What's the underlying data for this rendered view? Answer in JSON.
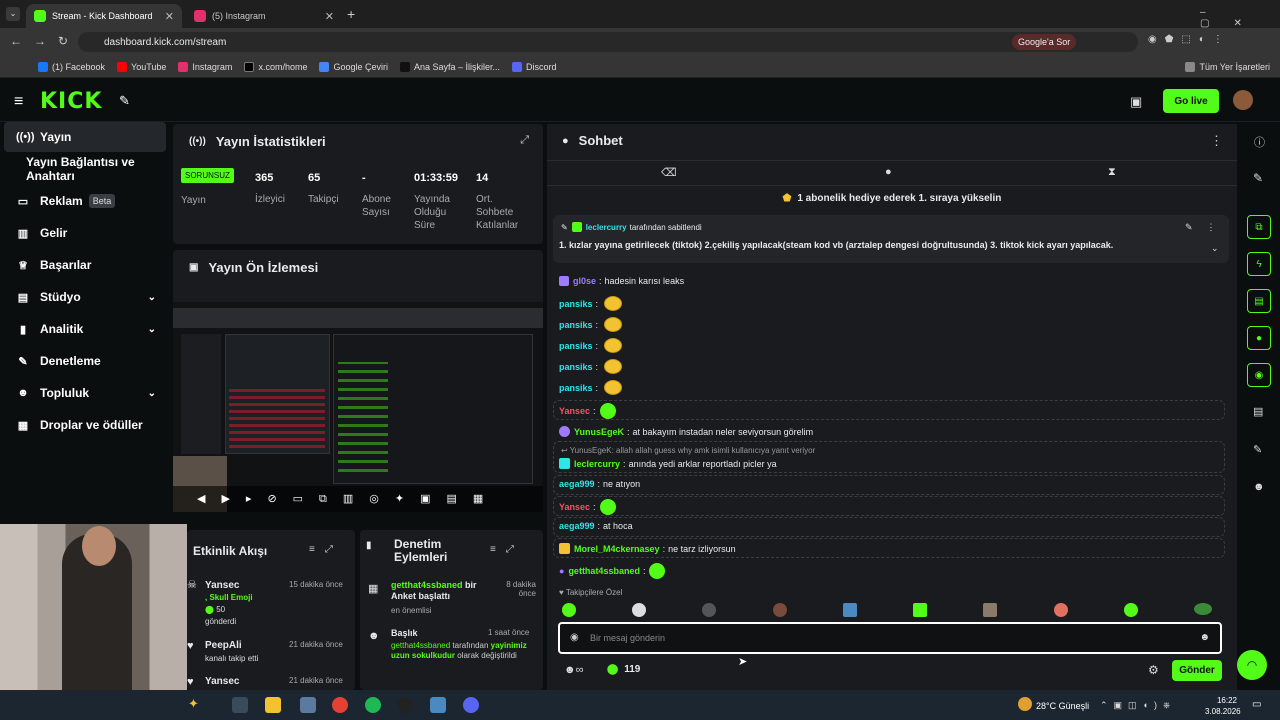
{
  "browser": {
    "tabs": [
      {
        "label": "Stream - Kick Dashboard"
      },
      {
        "label": "(5) Instagram"
      }
    ],
    "url": "dashboard.kick.com/stream",
    "google_btn": "Google'a Sor",
    "bookmarks": [
      "(1) Facebook",
      "YouTube",
      "Instagram",
      "x.com/home",
      "Google Çeviri",
      "Ana Sayfa – İlişkiler...",
      "Discord"
    ],
    "all_bookmarks": "Tüm Yer İşaretleri"
  },
  "header": {
    "logo": "KICK",
    "go_live": "Go live"
  },
  "sidebar": {
    "items": [
      {
        "label": "Yayın"
      },
      {
        "label": "Yayın Bağlantısı ve Anahtarı"
      },
      {
        "label": "Reklam",
        "badge": "Beta"
      },
      {
        "label": "Gelir"
      },
      {
        "label": "Başarılar"
      },
      {
        "label": "Stüdyo"
      },
      {
        "label": "Analitik"
      },
      {
        "label": "Denetleme"
      },
      {
        "label": "Topluluk"
      },
      {
        "label": "Droplar ve ödüller"
      }
    ]
  },
  "stats": {
    "title": "Yayın İstatistikleri",
    "badge": "SORUNSUZ",
    "items": [
      {
        "value": "",
        "label": "Yayın"
      },
      {
        "value": "365",
        "label": "İzleyici"
      },
      {
        "value": "65",
        "label": "Takipçi"
      },
      {
        "value": "-",
        "label": "Abone Sayısı"
      },
      {
        "value": "01:33:59",
        "label": "Yayında Olduğu Süre"
      },
      {
        "value": "14",
        "label": "Ort. Sohbete Katılanlar"
      }
    ]
  },
  "preview": {
    "title": "Yayın Ön İzlemesi"
  },
  "activity": {
    "title": "Etkinlik Akışı",
    "items": [
      {
        "user": "Yansec",
        "time": "15 dakika önce",
        "line1": ", Skull Emoji",
        "line2": "50",
        "line3": "gönderdi"
      },
      {
        "user": "PeepAli",
        "time": "21 dakika önce",
        "line1": "kanalı takip etti"
      },
      {
        "user": "Yansec",
        "time": "21 dakika önce"
      }
    ]
  },
  "moderation": {
    "title": "Denetim Eylemleri",
    "items": [
      {
        "user": "getthat4ssbaned",
        "text": "bir Anket başlattı",
        "sub": "en önemlisi",
        "time": "8 dakika önce"
      },
      {
        "user": "Başlık",
        "time": "1 saat önce",
        "line1": "getthat4ssbaned",
        "line1b": "tarafından",
        "line2": "yayinimiz uzun sokulkudur",
        "line2b": "olarak değiştirildi"
      }
    ]
  },
  "chat": {
    "title": "Sohbet",
    "banner": "1 abonelik hediye ederek 1. sıraya yükselin",
    "pinned_by": "leclercurry",
    "pinned_suffix": "tarafından sabitlendi",
    "pinned_text": "1. kızlar yayına getirilecek (tiktok) 2.çekiliş yapılacak(steam kod vb (arztalep dengesi doğrultusunda) 3. tiktok kick ayarı yapılacak.",
    "messages": [
      {
        "user": "gl0se",
        "text": "hadesin karısı leaks",
        "color": "#9d7cff"
      },
      {
        "user": "pansiks",
        "text": "",
        "color": "#2ee6e6"
      },
      {
        "user": "pansiks",
        "text": "",
        "color": "#2ee6e6"
      },
      {
        "user": "pansiks",
        "text": "",
        "color": "#2ee6e6"
      },
      {
        "user": "pansiks",
        "text": "",
        "color": "#2ee6e6"
      },
      {
        "user": "pansiks",
        "text": "",
        "color": "#2ee6e6"
      },
      {
        "user": "Yansec",
        "text": "",
        "color": "#ff4d6a"
      },
      {
        "user": "YunusEgeK",
        "text": "at bakayım instadan neler seviyorsun görelim",
        "color": "#53fc18"
      },
      {
        "user": "leclercurry",
        "text": "anında yedi arklar reportladı picler ya",
        "color": "#53fc18",
        "reply": "YunusEgeK: allah allah guess why amk isimli kullanıcıya yanıt veriyor"
      },
      {
        "user": "aega999",
        "text": "ne atıyon",
        "color": "#2ee6e6"
      },
      {
        "user": "Yansec",
        "text": "",
        "color": "#ff4d6a"
      },
      {
        "user": "aega999",
        "text": "at hoca",
        "color": "#2ee6e6"
      },
      {
        "user": "Morel_M4ckernasey",
        "text": "ne tarz izliyorsun",
        "color": "#53fc18"
      },
      {
        "user": "getthat4ssbaned",
        "text": "",
        "color": "#53fc18"
      }
    ],
    "emote_label": "Takipçilere Özel",
    "input_placeholder": "Bir mesaj gönderin",
    "points": "119",
    "send": "Gönder"
  },
  "taskbar": {
    "weather": "28°C Güneşli",
    "time": "16:22",
    "date": "3.08.2026"
  }
}
